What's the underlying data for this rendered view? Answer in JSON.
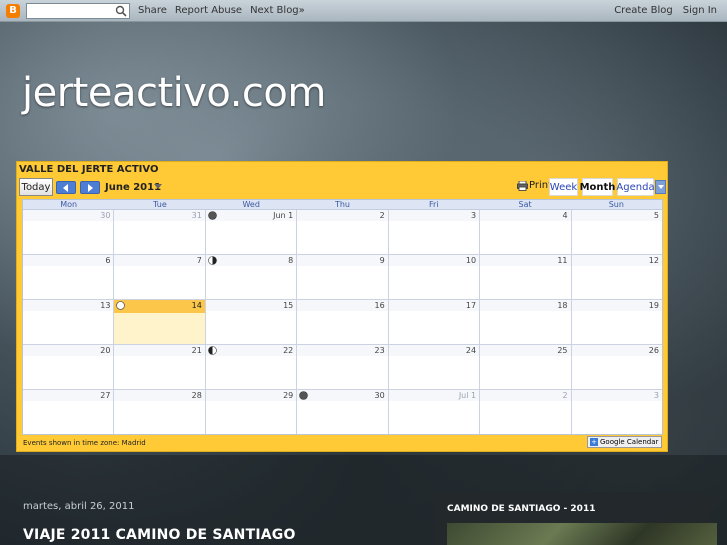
{
  "navbar": {
    "blogger_letter": "B",
    "search_placeholder": "",
    "links": [
      "Share",
      "Report Abuse",
      "Next Blog»"
    ],
    "right_links": [
      "Create Blog",
      "Sign In"
    ]
  },
  "blog": {
    "title": "jerteactivo.com"
  },
  "calendar": {
    "title": "VALLE DEL JERTE ACTIVO",
    "today_label": "Today",
    "month_label": "June 2011",
    "print_label": "Print",
    "views": [
      "Week",
      "Month",
      "Agenda"
    ],
    "active_view": "Month",
    "days_of_week": [
      "Mon",
      "Tue",
      "Wed",
      "Thu",
      "Fri",
      "Sat",
      "Sun"
    ],
    "weeks": [
      [
        {
          "n": "30",
          "other": true
        },
        {
          "n": "31",
          "other": true
        },
        {
          "n": "Jun 1",
          "moon": "new"
        },
        {
          "n": "2"
        },
        {
          "n": "3"
        },
        {
          "n": "4"
        },
        {
          "n": "5"
        }
      ],
      [
        {
          "n": "6"
        },
        {
          "n": "7"
        },
        {
          "n": "8",
          "moon": "first"
        },
        {
          "n": "9"
        },
        {
          "n": "10"
        },
        {
          "n": "11"
        },
        {
          "n": "12"
        }
      ],
      [
        {
          "n": "13"
        },
        {
          "n": "14",
          "today": true,
          "moon": "full"
        },
        {
          "n": "15"
        },
        {
          "n": "16"
        },
        {
          "n": "17"
        },
        {
          "n": "18"
        },
        {
          "n": "19"
        }
      ],
      [
        {
          "n": "20"
        },
        {
          "n": "21"
        },
        {
          "n": "22",
          "moon": "last"
        },
        {
          "n": "23"
        },
        {
          "n": "24"
        },
        {
          "n": "25"
        },
        {
          "n": "26"
        }
      ],
      [
        {
          "n": "27"
        },
        {
          "n": "28"
        },
        {
          "n": "29"
        },
        {
          "n": "30",
          "moon": "new"
        },
        {
          "n": "Jul 1",
          "other": true
        },
        {
          "n": "2",
          "other": true
        },
        {
          "n": "3",
          "other": true
        }
      ]
    ],
    "timezone_note": "Events shown in time zone: Madrid",
    "badge_text": "Google Calendar",
    "badge_plus": "+"
  },
  "post": {
    "date": "martes, abril 26, 2011",
    "title": "VIAJE 2011 CAMINO DE SANTIAGO"
  },
  "sidebar": {
    "title": "CAMINO DE SANTIAGO - 2011"
  },
  "colors": {
    "calendar_bg": "#ffca36",
    "today_cell": "#fff3cc",
    "today_head": "#fbc64a",
    "nav_arrow": "#4d7ed4",
    "link_blue": "#2a45b8"
  }
}
